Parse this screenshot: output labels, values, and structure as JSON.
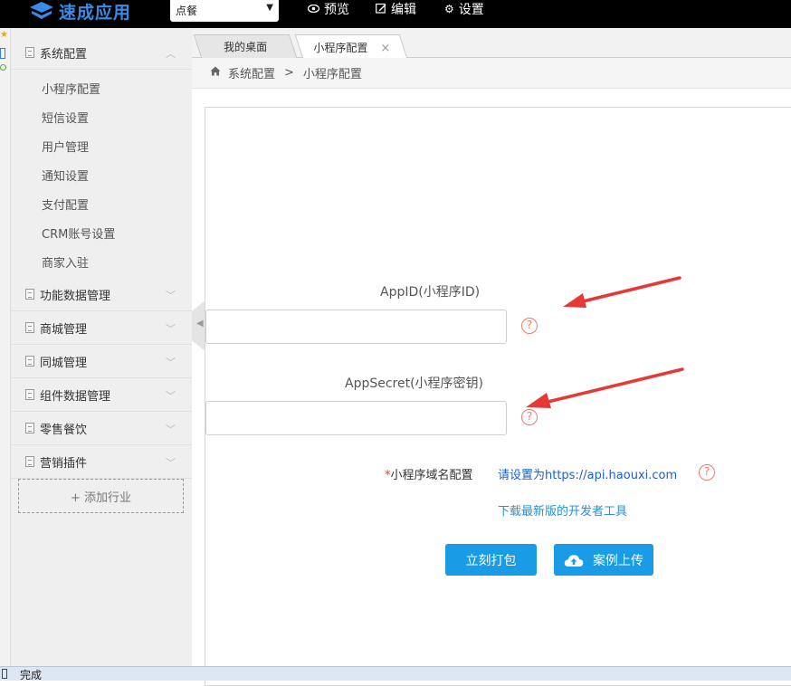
{
  "topbar": {
    "brand": "速成应用",
    "select_value": "点餐",
    "nav": [
      {
        "icon": "eye-icon",
        "label": "预览"
      },
      {
        "icon": "edit-icon",
        "label": "编辑"
      },
      {
        "icon": "gear-icon",
        "label": "设置"
      }
    ]
  },
  "sidebar": {
    "groups": [
      {
        "label": "系统配置",
        "expanded": true
      },
      {
        "label": "功能数据管理"
      },
      {
        "label": "商城管理"
      },
      {
        "label": "同城管理"
      },
      {
        "label": "组件数据管理"
      },
      {
        "label": "零售餐饮"
      },
      {
        "label": "营销插件"
      }
    ],
    "subitems": [
      "小程序配置",
      "短信设置",
      "用户管理",
      "通知设置",
      "支付配置",
      "CRM账号设置",
      "商家入驻"
    ],
    "add_label": "+ 添加行业"
  },
  "tabs": [
    {
      "label": "我的桌面",
      "active": false
    },
    {
      "label": "小程序配置",
      "active": true,
      "close": "×"
    }
  ],
  "breadcrumb": {
    "root": "系统配置",
    "sep": ">",
    "current": "小程序配置"
  },
  "form": {
    "appid_label": "AppID(小程序ID)",
    "appid_value": "",
    "appsecret_label": "AppSecret(小程序密钥)",
    "appsecret_value": "",
    "help_glyph": "?",
    "domain_required_mark": "*",
    "domain_label": "小程序域名配置",
    "domain_value": "请设置为https://api.haouxi.com",
    "download_link": "下载最新版的开发者工具",
    "pack_button": "立刻打包",
    "upload_button": "案例上传"
  },
  "statusbar": {
    "text": "完成"
  },
  "colors": {
    "accent": "#1a9be6",
    "help": "#ef7b6c",
    "arrow": "#e53935",
    "brand": "#3a8be6"
  }
}
